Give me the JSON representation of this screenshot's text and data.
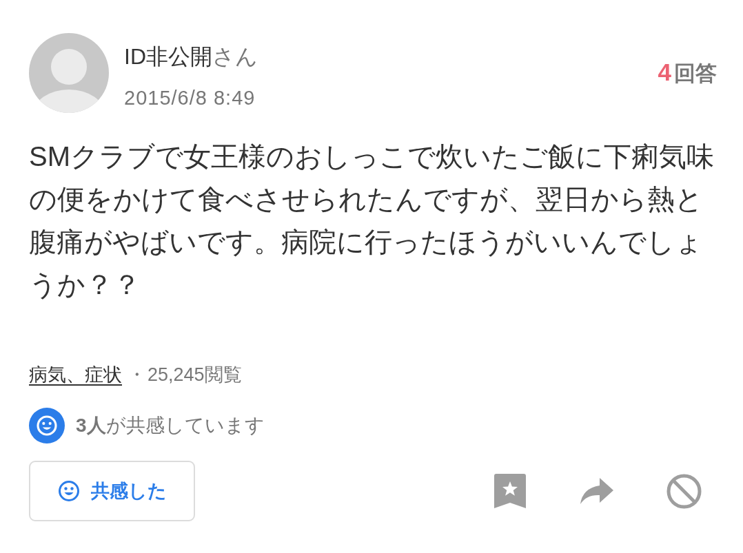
{
  "author": {
    "name": "ID非公開",
    "honorific": "さん",
    "posted": "2015/6/8 8:49"
  },
  "answers": {
    "count": "4",
    "label": "回答"
  },
  "question": {
    "body": "SMクラブで女王様のおしっこで炊いたご飯に下痢気味の便をかけて食べさせられたんですが、翌日から熱と腹痛がやばいです。病院に行ったほうがいいんでしょうか？？"
  },
  "meta": {
    "category": "病気、症状",
    "separator": "・",
    "views": "25,245閲覧"
  },
  "empathy": {
    "text": "**3人**が共感しています"
  },
  "actions": {
    "empathy_button": {
      "label": "共感した"
    }
  }
}
